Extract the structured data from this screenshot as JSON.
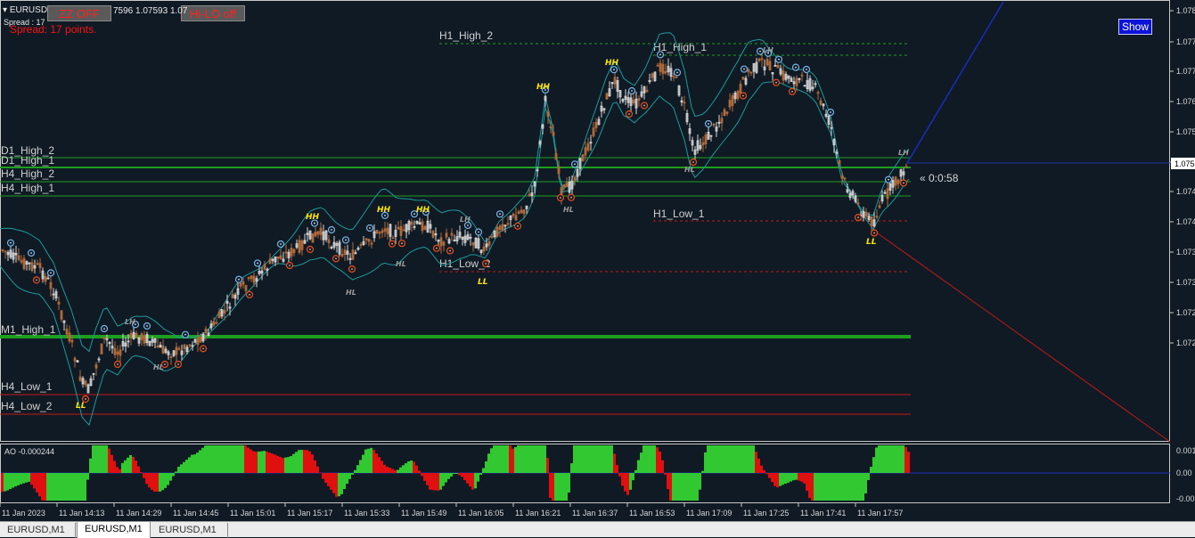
{
  "symbol_info": {
    "title": "EURUSD",
    "quote": "7596 1.07593 1.07",
    "spread_label": "Spread : 17"
  },
  "spread_text": "Spread: 17 points.",
  "buttons": {
    "zz": "ZZ OFF",
    "hilo": "Hi-LO off",
    "show": "Show"
  },
  "timer": "« 0:0:58",
  "levels": {
    "h1_high_2": "H1_High_2",
    "h1_high_1": "H1_High_1",
    "h1_low_1": "H1_Low_1",
    "h1_low_2": "H1_Low_2",
    "d1_high_2": "D1_High_2",
    "d1_high_1": "D1_High_1",
    "h4_high_2": "H4_High_2",
    "h4_high_1": "H4_High_1",
    "m1_high_1": "M1_High_1",
    "h4_low_1": "H4_Low_1",
    "h4_low_2": "H4_Low_2"
  },
  "swing_labels": {
    "hh": "HH",
    "ll": "LL",
    "lh": "LH",
    "hl": "HL"
  },
  "ao_label": "AO -0.000244",
  "price_ticks": [
    "1.078",
    "1.077",
    "1.077",
    "1.076",
    "1.075",
    "1.075",
    "1.074",
    "1.074",
    "1.073",
    "1.073",
    "1.072",
    "1.072"
  ],
  "current_price_label": "1.075",
  "ao_ticks": [
    "0.001",
    "0.00",
    "-0.001"
  ],
  "time_labels": [
    "11 Jan 2023",
    "11 Jan 14:13",
    "11 Jan 14:29",
    "11 Jan 14:45",
    "11 Jan 15:01",
    "11 Jan 15:17",
    "11 Jan 15:33",
    "11 Jan 15:49",
    "11 Jan 16:05",
    "11 Jan 16:21",
    "11 Jan 16:37",
    "11 Jan 16:53",
    "11 Jan 17:09",
    "11 Jan 17:25",
    "11 Jan 17:41",
    "11 Jan 17:57"
  ],
  "tabs": [
    "EURUSD,M1",
    "EURUSD,M1",
    "EURUSD,M1"
  ],
  "colors": {
    "background": "#0f1a24",
    "bull": "#d8d8d8",
    "bear": "#b06a3a",
    "level_green": "#1ea01e",
    "level_red": "#c81818",
    "ao_green": "#32c832",
    "ao_red": "#e01010",
    "bands": "#1e9a9a"
  }
}
